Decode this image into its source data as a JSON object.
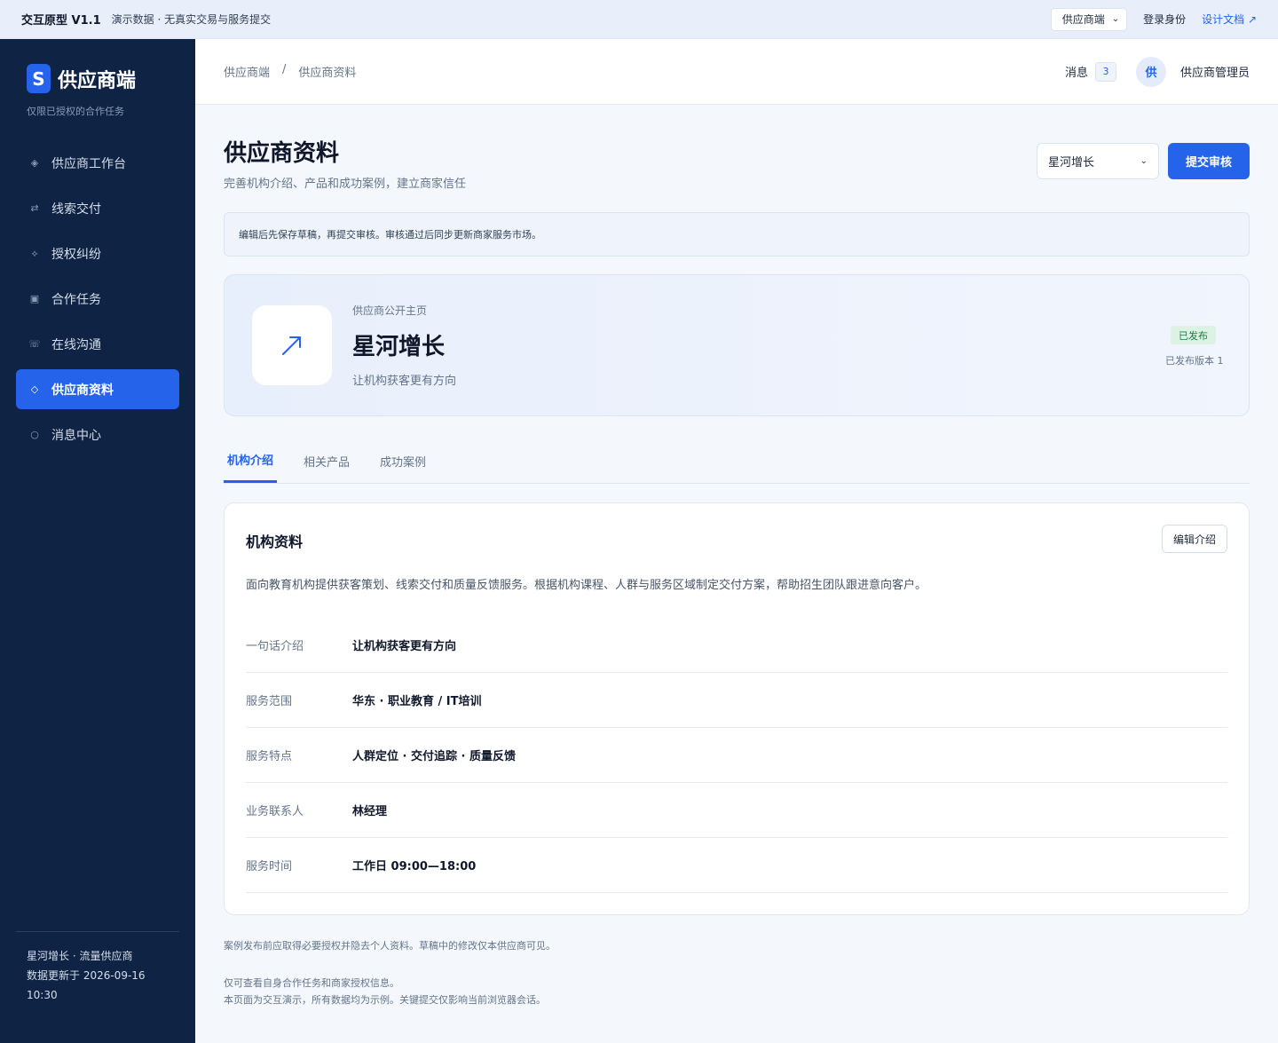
{
  "banner": {
    "proto": "交互原型 V1.1",
    "demo": "演示数据 · 无真实交易与服务提交",
    "portal_select": "供应商端",
    "login_role": "登录身份",
    "design_doc": "设计文档 ↗"
  },
  "sidebar": {
    "logo_letter": "S",
    "brand": "供应商端",
    "brand_sub": "仅限已授权的合作任务",
    "items": [
      {
        "label": "供应商工作台",
        "icon": "◈"
      },
      {
        "label": "线索交付",
        "icon": "⇄"
      },
      {
        "label": "授权纠纷",
        "icon": "⟡"
      },
      {
        "label": "合作任务",
        "icon": "▣"
      },
      {
        "label": "在线沟通",
        "icon": "☏"
      },
      {
        "label": "供应商资料",
        "icon": "◇"
      },
      {
        "label": "消息中心",
        "icon": "○"
      }
    ],
    "footer_org": "星河增长 · 流量供应商",
    "footer_update": "数据更新于 2026-09-16",
    "footer_time": "10:30"
  },
  "header": {
    "crumb_root": "供应商端",
    "crumb_sep": "/",
    "crumb_current": "供应商资料",
    "messages_label": "消息",
    "messages_count": "3",
    "avatar": "供",
    "user": "供应商管理员"
  },
  "page": {
    "title": "供应商资料",
    "subtitle": "完善机构介绍、产品和成功案例，建立商家信任",
    "org_select": "星河增长",
    "submit": "提交审核",
    "notice": "编辑后先保存草稿，再提交审核。审核通过后同步更新商家服务市场。"
  },
  "hero": {
    "label": "供应商公开主页",
    "name": "星河增长",
    "tagline": "让机构获客更有方向",
    "badge": "已发布",
    "version": "已发布版本 1"
  },
  "tabs": [
    "机构介绍",
    "相关产品",
    "成功案例"
  ],
  "card": {
    "title": "机构资料",
    "edit": "编辑介绍",
    "desc": "面向教育机构提供获客策划、线索交付和质量反馈服务。根据机构课程、人群与服务区域制定交付方案，帮助招生团队跟进意向客户。",
    "rows": [
      {
        "k": "一句话介绍",
        "v": "让机构获客更有方向"
      },
      {
        "k": "服务范围",
        "v": "华东 · 职业教育 / IT培训"
      },
      {
        "k": "服务特点",
        "v": "人群定位 · 交付追踪 · 质量反馈"
      },
      {
        "k": "业务联系人",
        "v": "林经理"
      },
      {
        "k": "服务时间",
        "v": "工作日 09:00—18:00"
      }
    ]
  },
  "footer": {
    "note": "案例发布前应取得必要授权并隐去个人资料。草稿中的修改仅本供应商可见。",
    "line1": "仅可查看自身合作任务和商家授权信息。",
    "line2": "本页面为交互演示，所有数据均为示例。关键提交仅影响当前浏览器会话。"
  },
  "colors": {
    "accent": "#2563eb",
    "sidebar_bg": "#0f2344",
    "published_badge": "#1a7a45"
  }
}
